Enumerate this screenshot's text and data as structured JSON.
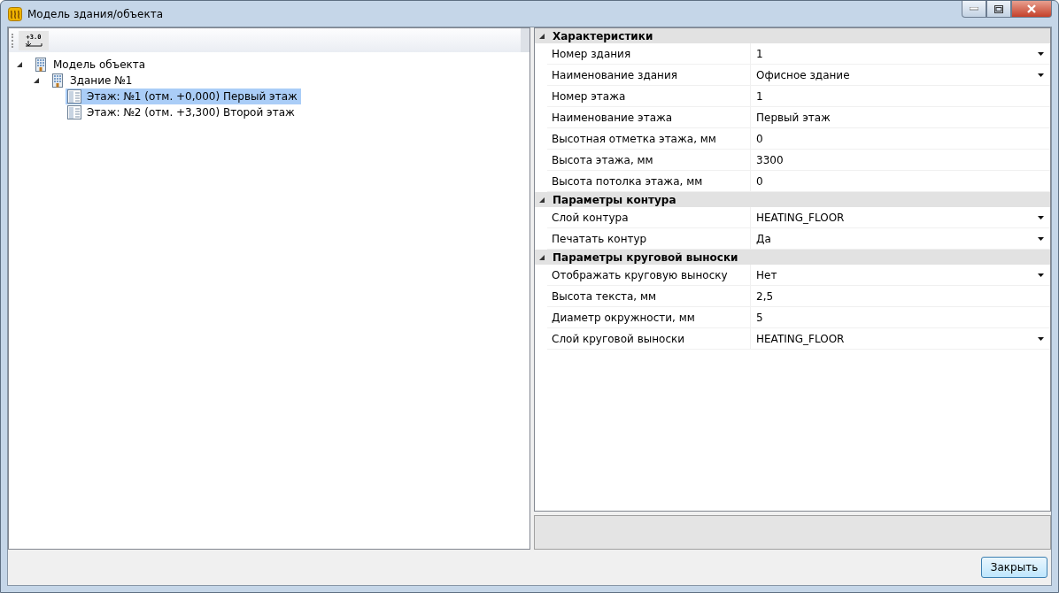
{
  "window": {
    "title": "Модель здания/объекта"
  },
  "toolbar": {
    "elevation_button": "+3.0"
  },
  "tree": [
    {
      "label": "Модель объекта",
      "expanded": true,
      "selected": false,
      "children": [
        {
          "label": "Здание №1",
          "expanded": true,
          "selected": false,
          "children": [
            {
              "label": "Этаж: №1 (отм. +0,000) Первый этаж",
              "selected": true
            },
            {
              "label": "Этаж: №2 (отм. +3,300) Второй этаж",
              "selected": false
            }
          ]
        }
      ]
    }
  ],
  "properties": [
    {
      "category": "Характеристики",
      "expanded": true,
      "rows": [
        {
          "name": "Номер здания",
          "value": "1",
          "kind": "dropdown"
        },
        {
          "name": "Наименование здания",
          "value": "Офисное здание",
          "kind": "dropdown"
        },
        {
          "name": "Номер этажа",
          "value": "1",
          "kind": "text"
        },
        {
          "name": "Наименование этажа",
          "value": "Первый этаж",
          "kind": "text"
        },
        {
          "name": "Высотная отметка этажа, мм",
          "value": "0",
          "kind": "text"
        },
        {
          "name": "Высота этажа, мм",
          "value": "3300",
          "kind": "text"
        },
        {
          "name": "Высота потолка этажа, мм",
          "value": "0",
          "kind": "text"
        }
      ]
    },
    {
      "category": "Параметры контура",
      "expanded": true,
      "rows": [
        {
          "name": "Слой контура",
          "value": "HEATING_FLOOR",
          "kind": "dropdown"
        },
        {
          "name": "Печатать контур",
          "value": "Да",
          "kind": "dropdown"
        }
      ]
    },
    {
      "category": "Параметры круговой выноски",
      "expanded": true,
      "rows": [
        {
          "name": "Отображать круговую выноску",
          "value": "Нет",
          "kind": "dropdown"
        },
        {
          "name": "Высота текста, мм",
          "value": "2,5",
          "kind": "text"
        },
        {
          "name": "Диаметр окружности, мм",
          "value": "5",
          "kind": "text"
        },
        {
          "name": "Слой круговой выноски",
          "value": "HEATING_FLOOR",
          "kind": "dropdown"
        }
      ]
    }
  ],
  "buttons": [
    {
      "label": "Закрыть"
    }
  ]
}
